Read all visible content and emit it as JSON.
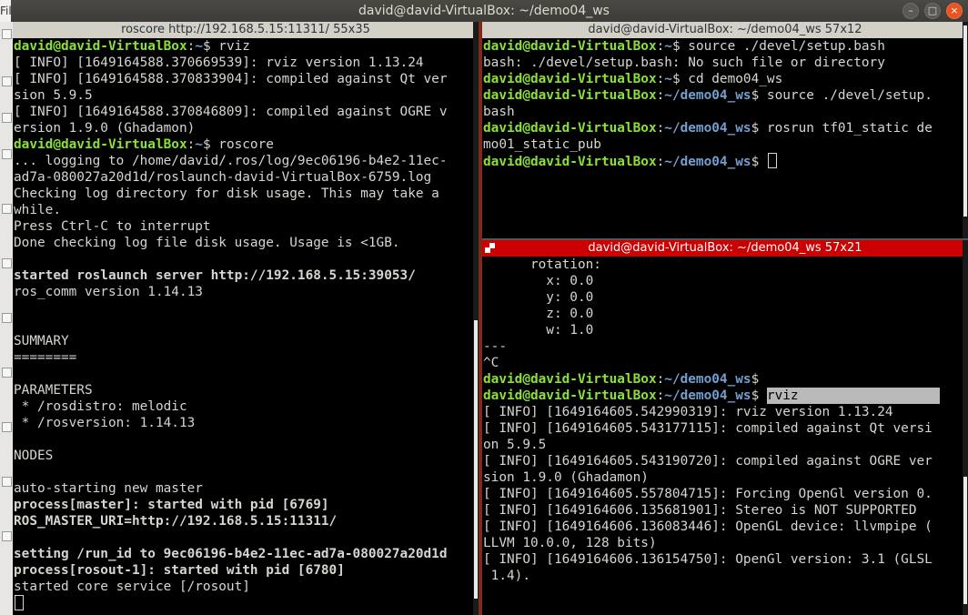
{
  "window": {
    "title": "david@david-VirtualBox: ~/demo04_ws",
    "left_stub": "File",
    "minimize_glyph": "–",
    "maximize_glyph": "□",
    "close_glyph": "×"
  },
  "panes": {
    "left": {
      "title": "roscore http://192.168.5.15:11311/ 55x35",
      "lines": [
        [
          {
            "t": "david@david-VirtualBox",
            "c": "u"
          },
          {
            "t": ":"
          },
          {
            "t": "~",
            "c": "p"
          },
          {
            "t": "$ rviz"
          }
        ],
        [
          {
            "t": "[ INFO] [1649164588.370669539]: rviz version 1.13.24"
          }
        ],
        [
          {
            "t": "[ INFO] [1649164588.370833904]: compiled against Qt ver"
          }
        ],
        [
          {
            "t": "sion 5.9.5"
          }
        ],
        [
          {
            "t": "[ INFO] [1649164588.370846809]: compiled against OGRE v"
          }
        ],
        [
          {
            "t": "ersion 1.9.0 (Ghadamon)"
          }
        ],
        [
          {
            "t": "david@david-VirtualBox",
            "c": "u"
          },
          {
            "t": ":"
          },
          {
            "t": "~",
            "c": "p"
          },
          {
            "t": "$ roscore"
          }
        ],
        [
          {
            "t": "... logging to /home/david/.ros/log/9ec06196-b4e2-11ec-"
          }
        ],
        [
          {
            "t": "ad7a-080027a20d1d/roslaunch-david-VirtualBox-6759.log"
          }
        ],
        [
          {
            "t": "Checking log directory for disk usage. This may take a"
          }
        ],
        [
          {
            "t": "while."
          }
        ],
        [
          {
            "t": "Press Ctrl-C to interrupt"
          }
        ],
        [
          {
            "t": "Done checking log file disk usage. Usage is <1GB."
          }
        ],
        [
          {
            "t": ""
          }
        ],
        [
          {
            "t": "started roslaunch server http://192.168.5.15:39053/",
            "c": "b"
          }
        ],
        [
          {
            "t": "ros_comm version 1.14.13"
          }
        ],
        [
          {
            "t": ""
          }
        ],
        [
          {
            "t": ""
          }
        ],
        [
          {
            "t": "SUMMARY"
          }
        ],
        [
          {
            "t": "========"
          }
        ],
        [
          {
            "t": ""
          }
        ],
        [
          {
            "t": "PARAMETERS"
          }
        ],
        [
          {
            "t": " * /rosdistro: melodic"
          }
        ],
        [
          {
            "t": " * /rosversion: 1.14.13"
          }
        ],
        [
          {
            "t": ""
          }
        ],
        [
          {
            "t": "NODES"
          }
        ],
        [
          {
            "t": ""
          }
        ],
        [
          {
            "t": "auto-starting new master"
          }
        ],
        [
          {
            "t": "process[master]: started with pid [6769]",
            "c": "b"
          }
        ],
        [
          {
            "t": "ROS_MASTER_URI=http://192.168.5.15:11311/",
            "c": "b"
          }
        ],
        [
          {
            "t": ""
          }
        ],
        [
          {
            "t": "setting /run_id to 9ec06196-b4e2-11ec-ad7a-080027a20d1d",
            "c": "b"
          }
        ],
        [
          {
            "t": "process[rosout-1]: started with pid [6780]",
            "c": "b"
          }
        ],
        [
          {
            "t": "started core service [/rosout]"
          }
        ],
        [
          {
            "t": "",
            "cursor": true
          }
        ]
      ]
    },
    "top_right": {
      "title": "david@david-VirtualBox: ~/demo04_ws 57x12",
      "lines": [
        [
          {
            "t": "david@david-VirtualBox",
            "c": "u"
          },
          {
            "t": ":"
          },
          {
            "t": "~",
            "c": "p"
          },
          {
            "t": "$ source ./devel/setup.bash"
          }
        ],
        [
          {
            "t": "bash: ./devel/setup.bash: No such file or directory"
          }
        ],
        [
          {
            "t": "david@david-VirtualBox",
            "c": "u"
          },
          {
            "t": ":"
          },
          {
            "t": "~",
            "c": "p"
          },
          {
            "t": "$ cd demo04_ws"
          }
        ],
        [
          {
            "t": "david@david-VirtualBox",
            "c": "u"
          },
          {
            "t": ":"
          },
          {
            "t": "~/demo04_ws",
            "c": "p"
          },
          {
            "t": "$ source ./devel/setup."
          }
        ],
        [
          {
            "t": "bash"
          }
        ],
        [
          {
            "t": "david@david-VirtualBox",
            "c": "u"
          },
          {
            "t": ":"
          },
          {
            "t": "~/demo04_ws",
            "c": "p"
          },
          {
            "t": "$ rosrun tf01_static de"
          }
        ],
        [
          {
            "t": "mo01_static_pub"
          }
        ],
        [
          {
            "t": "david@david-VirtualBox",
            "c": "u"
          },
          {
            "t": ":"
          },
          {
            "t": "~/demo04_ws",
            "c": "p"
          },
          {
            "t": "$ ",
            "cursor": true
          }
        ]
      ]
    },
    "bottom_right": {
      "title": "david@david-VirtualBox: ~/demo04_ws 57x21",
      "lines": [
        [
          {
            "t": "      rotation:"
          }
        ],
        [
          {
            "t": "        x: 0.0"
          }
        ],
        [
          {
            "t": "        y: 0.0"
          }
        ],
        [
          {
            "t": "        z: 0.0"
          }
        ],
        [
          {
            "t": "        w: 1.0"
          }
        ],
        [
          {
            "t": "---"
          }
        ],
        [
          {
            "t": "^C"
          }
        ],
        [
          {
            "t": "david@david-VirtualBox",
            "c": "u"
          },
          {
            "t": ":"
          },
          {
            "t": "~/demo04_ws",
            "c": "p"
          },
          {
            "t": "$"
          }
        ],
        [
          {
            "t": "david@david-VirtualBox",
            "c": "u"
          },
          {
            "t": ":"
          },
          {
            "t": "~/demo04_ws",
            "c": "p"
          },
          {
            "t": "$ "
          },
          {
            "t": "rviz",
            "c": "sel"
          }
        ],
        [
          {
            "t": "[ INFO] [1649164605.542990319]: rviz version 1.13.24"
          }
        ],
        [
          {
            "t": "[ INFO] [1649164605.543177115]: compiled against Qt versi"
          }
        ],
        [
          {
            "t": "on 5.9.5"
          }
        ],
        [
          {
            "t": "[ INFO] [1649164605.543190720]: compiled against OGRE ver"
          }
        ],
        [
          {
            "t": "sion 1.9.0 (Ghadamon)"
          }
        ],
        [
          {
            "t": "[ INFO] [1649164605.557804715]: Forcing OpenGl version 0."
          }
        ],
        [
          {
            "t": "[ INFO] [1649164606.135681901]: Stereo is NOT SUPPORTED"
          }
        ],
        [
          {
            "t": "[ INFO] [1649164606.136083446]: OpenGL device: llvmpipe ("
          }
        ],
        [
          {
            "t": "LLVM 10.0.0, 128 bits)"
          }
        ],
        [
          {
            "t": "[ INFO] [1649164606.136154750]: OpenGl version: 3.1 (GLSL"
          }
        ],
        [
          {
            "t": " 1.4)."
          }
        ]
      ]
    }
  }
}
